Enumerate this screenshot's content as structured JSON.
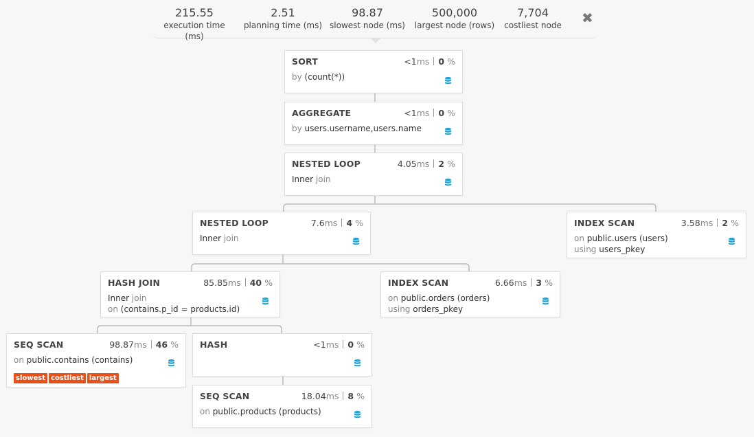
{
  "summary": {
    "execution_time": {
      "value": "215.55",
      "label": "execution time (ms)"
    },
    "planning_time": {
      "value": "2.51",
      "label": "planning time (ms)"
    },
    "slowest_node": {
      "value": "98.87",
      "label": "slowest node (ms)"
    },
    "largest_node": {
      "value": "500,000",
      "label": "largest node (rows)"
    },
    "costliest_node": {
      "value": "7,704",
      "label": "costliest node"
    }
  },
  "icons": {
    "close": "close-icon",
    "database": "database-icon"
  },
  "colors": {
    "accent": "#1aa3d6",
    "tag": "#e8521a"
  },
  "nodes": {
    "sort": {
      "title": "SORT",
      "time": "<1",
      "unit": "ms",
      "pct": "0",
      "pct_unit": "%",
      "k1": "by",
      "v1": "(count(*))"
    },
    "aggregate": {
      "title": "AGGREGATE",
      "time": "<1",
      "unit": "ms",
      "pct": "0",
      "pct_unit": "%",
      "k1": "by",
      "v1": "users.username,users.name"
    },
    "nested_loop_1": {
      "title": "NESTED LOOP",
      "time": "4.05",
      "unit": "ms",
      "pct": "2",
      "pct_unit": "%",
      "v1": "Inner",
      "k1": "join"
    },
    "nested_loop_2": {
      "title": "NESTED LOOP",
      "time": "7.6",
      "unit": "ms",
      "pct": "4",
      "pct_unit": "%",
      "v1": "Inner",
      "k1": "join"
    },
    "index_scan_users": {
      "title": "INDEX SCAN",
      "time": "3.58",
      "unit": "ms",
      "pct": "2",
      "pct_unit": "%",
      "k1": "on",
      "v1": "public.users (users)",
      "k2": "using",
      "v2": "users_pkey"
    },
    "hash_join": {
      "title": "HASH JOIN",
      "time": "85.85",
      "unit": "ms",
      "pct": "40",
      "pct_unit": "%",
      "v1": "Inner",
      "k1": "join",
      "k2": "on",
      "v2": "(contains.p_id = products.id)"
    },
    "index_scan_orders": {
      "title": "INDEX SCAN",
      "time": "6.66",
      "unit": "ms",
      "pct": "3",
      "pct_unit": "%",
      "k1": "on",
      "v1": "public.orders (orders)",
      "k2": "using",
      "v2": "orders_pkey"
    },
    "seq_scan_contains": {
      "title": "SEQ SCAN",
      "time": "98.87",
      "unit": "ms",
      "pct": "46",
      "pct_unit": "%",
      "k1": "on",
      "v1": "public.contains (contains)",
      "tags": [
        "slowest",
        "costliest",
        "largest"
      ]
    },
    "hash": {
      "title": "HASH",
      "time": "<1",
      "unit": "ms",
      "pct": "0",
      "pct_unit": "%"
    },
    "seq_scan_products": {
      "title": "SEQ SCAN",
      "time": "18.04",
      "unit": "ms",
      "pct": "8",
      "pct_unit": "%",
      "k1": "on",
      "v1": "public.products (products)"
    }
  }
}
